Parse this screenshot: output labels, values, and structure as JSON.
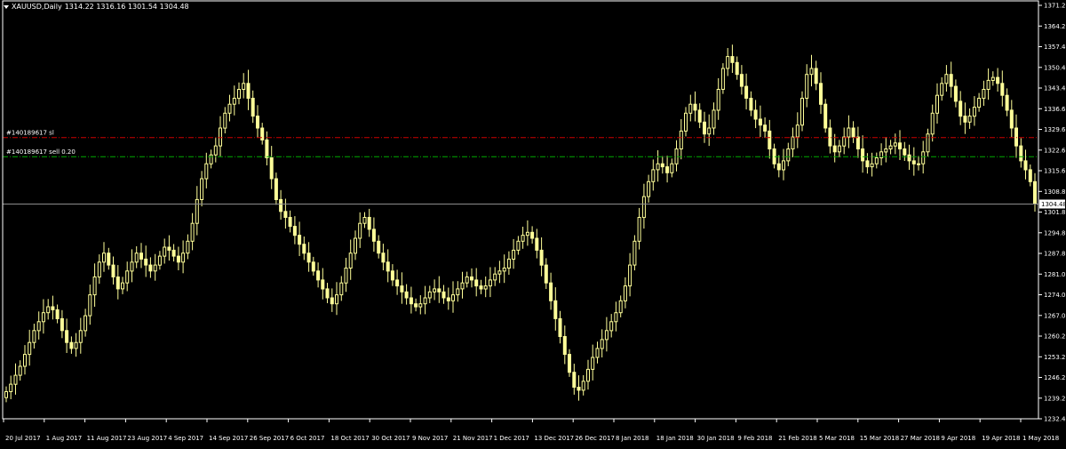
{
  "header": {
    "symbol": "XAUUSD,Daily",
    "ohlc": "1314.22 1316.16 1301.54 1304.48"
  },
  "colors": {
    "background": "#000000",
    "candle": "#ffff99",
    "axis": "#ffffff",
    "stop_loss_line": "#cc0000",
    "entry_line": "#00aa00",
    "price_line": "#8c8c8c"
  },
  "chart_data": {
    "type": "candlestick",
    "title": "XAUUSD,Daily",
    "grid": false,
    "ylim": [
      1232.4,
      1371.2
    ],
    "yticks": [
      "1371.20",
      "1364.20",
      "1357.40",
      "1350.40",
      "1343.40",
      "1336.60",
      "1329.60",
      "1322.60",
      "1315.60",
      "1308.80",
      "1301.80",
      "1294.80",
      "1287.80",
      "1281.00",
      "1274.00",
      "1267.00",
      "1260.20",
      "1253.20",
      "1246.20",
      "1239.20",
      "1232.40"
    ],
    "xticks": [
      "20 Jul 2017",
      "1 Aug 2017",
      "11 Aug 2017",
      "23 Aug 2017",
      "4 Sep 2017",
      "14 Sep 2017",
      "26 Sep 2017",
      "6 Oct 2017",
      "18 Oct 2017",
      "30 Oct 2017",
      "9 Nov 2017",
      "21 Nov 2017",
      "1 Dec 2017",
      "13 Dec 2017",
      "26 Dec 2017",
      "8 Jan 2018",
      "18 Jan 2018",
      "30 Jan 2018",
      "9 Feb 2018",
      "21 Feb 2018",
      "5 Mar 2018",
      "15 Mar 2018",
      "27 Mar 2018",
      "9 Apr 2018",
      "19 Apr 2018",
      "1 May 2018"
    ],
    "close_series": [
      1241.5,
      1244.0,
      1247.0,
      1250.0,
      1254.0,
      1258.0,
      1262.0,
      1265.0,
      1268.0,
      1270.0,
      1269.0,
      1266.0,
      1262.0,
      1258.0,
      1256.0,
      1258.0,
      1262.0,
      1267.0,
      1274.0,
      1280.0,
      1285.0,
      1288.0,
      1284.0,
      1280.0,
      1276.0,
      1278.0,
      1282.0,
      1285.0,
      1288.0,
      1286.0,
      1284.0,
      1282.0,
      1284.0,
      1287.0,
      1290.0,
      1289.0,
      1287.0,
      1285.0,
      1288.0,
      1292.0,
      1298.0,
      1306.0,
      1313.0,
      1318.0,
      1321.0,
      1324.0,
      1330.0,
      1335.0,
      1338.0,
      1340.0,
      1343.0,
      1345.0,
      1340.0,
      1334.0,
      1330.0,
      1326.0,
      1320.0,
      1313.0,
      1306.0,
      1302.0,
      1300.0,
      1297.0,
      1294.0,
      1291.0,
      1288.0,
      1285.0,
      1282.0,
      1279.0,
      1276.0,
      1273.0,
      1271.0,
      1274.0,
      1278.0,
      1283.0,
      1288.0,
      1293.0,
      1298.0,
      1300.0,
      1296.0,
      1292.0,
      1288.0,
      1285.0,
      1282.0,
      1279.0,
      1277.0,
      1275.0,
      1273.0,
      1271.0,
      1270.0,
      1271.0,
      1273.0,
      1275.0,
      1276.0,
      1275.0,
      1273.0,
      1272.0,
      1274.0,
      1276.0,
      1278.0,
      1280.0,
      1279.0,
      1277.0,
      1276.0,
      1277.0,
      1279.0,
      1281.0,
      1282.0,
      1283.0,
      1286.0,
      1289.0,
      1292.0,
      1294.0,
      1295.0,
      1293.0,
      1289.0,
      1284.0,
      1278.0,
      1272.0,
      1266.0,
      1260.0,
      1254.0,
      1248.0,
      1243.0,
      1242.0,
      1245.0,
      1249.0,
      1253.0,
      1256.0,
      1259.0,
      1262.0,
      1265.0,
      1268.0,
      1272.0,
      1277.0,
      1284.0,
      1292.0,
      1300.0,
      1307.0,
      1312.0,
      1316.0,
      1318.0,
      1317.0,
      1315.0,
      1318.0,
      1323.0,
      1329.0,
      1335.0,
      1338.0,
      1336.0,
      1332.0,
      1328.0,
      1330.0,
      1336.0,
      1343.0,
      1350.0,
      1354.0,
      1352.0,
      1348.0,
      1344.0,
      1340.0,
      1336.0,
      1333.0,
      1331.0,
      1329.0,
      1323.0,
      1318.0,
      1316.0,
      1319.0,
      1323.0,
      1327.0,
      1331.0,
      1340.0,
      1348.0,
      1350.0,
      1345.0,
      1338.0,
      1330.0,
      1324.0,
      1322.0,
      1324.0,
      1327.0,
      1330.0,
      1327.0,
      1323.0,
      1319.0,
      1317.0,
      1318.0,
      1320.0,
      1322.0,
      1323.0,
      1324.0,
      1325.0,
      1323.0,
      1321.0,
      1319.0,
      1318.0,
      1318.0,
      1322.0,
      1328.0,
      1335.0,
      1341.0,
      1345.0,
      1348.0,
      1344.0,
      1339.0,
      1334.0,
      1332.0,
      1334.0,
      1337.0,
      1340.0,
      1343.0,
      1346.0,
      1347.0,
      1345.0,
      1341.0,
      1336.0,
      1330.0,
      1324.0,
      1319.0,
      1316.0,
      1312.0,
      1304.48
    ],
    "annotations": [
      {
        "label": "#140189617 sl",
        "price": 1326.8,
        "style": "dash-dot",
        "color": "#cc0000"
      },
      {
        "label": "#140189617 sell 0.20",
        "price": 1320.4,
        "style": "dash-dot",
        "color": "#00aa00"
      }
    ],
    "current_price": {
      "label": "1304.48",
      "value": 1304.48
    }
  }
}
